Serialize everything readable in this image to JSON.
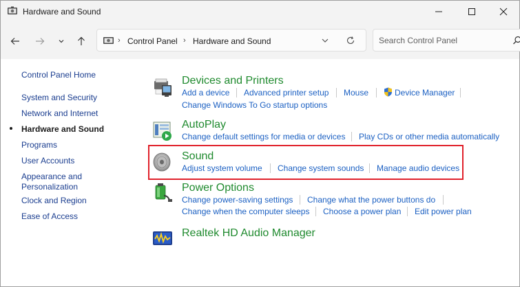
{
  "window": {
    "title": "Hardware and Sound"
  },
  "address": {
    "crumbs": [
      "Control Panel",
      "Hardware and Sound"
    ]
  },
  "search": {
    "placeholder": "Search Control Panel"
  },
  "sidebar": {
    "items": [
      {
        "label": "Control Panel Home"
      },
      {
        "label": "System and Security"
      },
      {
        "label": "Network and Internet"
      },
      {
        "label": "Hardware and Sound",
        "current": true
      },
      {
        "label": "Programs"
      },
      {
        "label": "User Accounts"
      },
      {
        "label": "Appearance and"
      },
      {
        "label": "Personalization"
      },
      {
        "label": "Clock and Region"
      },
      {
        "label": "Ease of Access"
      }
    ]
  },
  "categories": {
    "devices": {
      "title": "Devices and Printers",
      "tasks": [
        "Add a device",
        "Advanced printer setup",
        "Mouse",
        "Device Manager",
        "Change Windows To Go startup options"
      ]
    },
    "autoplay": {
      "title": "AutoPlay",
      "tasks": [
        "Change default settings for media or devices",
        "Play CDs or other media automatically"
      ]
    },
    "sound": {
      "title": "Sound",
      "tasks": [
        "Adjust system volume",
        "Change system sounds",
        "Manage audio devices"
      ]
    },
    "power": {
      "title": "Power Options",
      "tasks": [
        "Change power-saving settings",
        "Change what the power buttons do",
        "Change when the computer sleeps",
        "Choose a power plan",
        "Edit power plan"
      ]
    },
    "realtek": {
      "title": "Realtek HD Audio Manager"
    }
  },
  "colors": {
    "category_title": "#1f8a2e",
    "task_link": "#1a5fc2",
    "highlight_box": "#e0202a"
  }
}
